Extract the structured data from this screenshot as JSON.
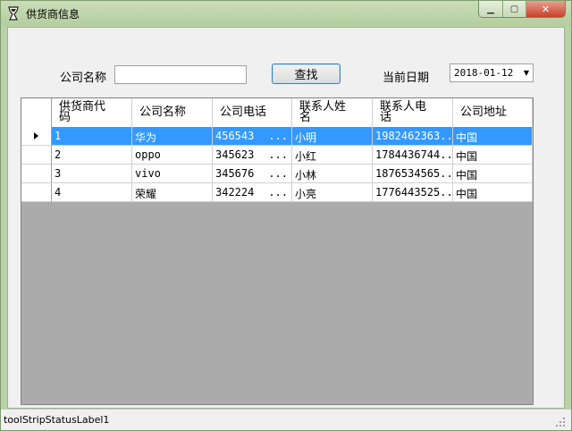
{
  "window": {
    "title": "供货商信息",
    "controls": {
      "minimize": "▁",
      "maximize": "▢",
      "close": "✕"
    }
  },
  "search": {
    "company_label": "公司名称",
    "company_value": "",
    "search_button": "查找",
    "date_label": "当前日期",
    "date_value": "2018-01-12"
  },
  "grid": {
    "columns": [
      {
        "line1": "供货商代",
        "line2": "码"
      },
      {
        "line1": "公司名称",
        "line2": ""
      },
      {
        "line1": "公司电话",
        "line2": ""
      },
      {
        "line1": "联系人姓",
        "line2": "名"
      },
      {
        "line1": "联系人电",
        "line2": "话"
      },
      {
        "line1": "公司地址",
        "line2": ""
      }
    ],
    "rows": [
      {
        "id": "1",
        "name": "华为",
        "phone": "456543",
        "phone_more": "...",
        "contact": "小明",
        "contact_phone": "1982462363...",
        "address": "中国"
      },
      {
        "id": "2",
        "name": "oppo",
        "phone": "345623",
        "phone_more": "...",
        "contact": "小红",
        "contact_phone": "1784436744...",
        "address": "中国"
      },
      {
        "id": "3",
        "name": "vivo",
        "phone": "345676",
        "phone_more": "...",
        "contact": "小林",
        "contact_phone": "1876534565...",
        "address": "中国"
      },
      {
        "id": "4",
        "name": "荣耀",
        "phone": "342224",
        "phone_more": "...",
        "contact": "小亮",
        "contact_phone": "1776443525...",
        "address": "中国"
      }
    ],
    "selected_row": 0
  },
  "status": {
    "label": "toolStripStatusLabel1"
  },
  "colors": {
    "selection": "#3399ff",
    "grid_bg": "#ababab",
    "titlebar": "#b9d1a6"
  }
}
